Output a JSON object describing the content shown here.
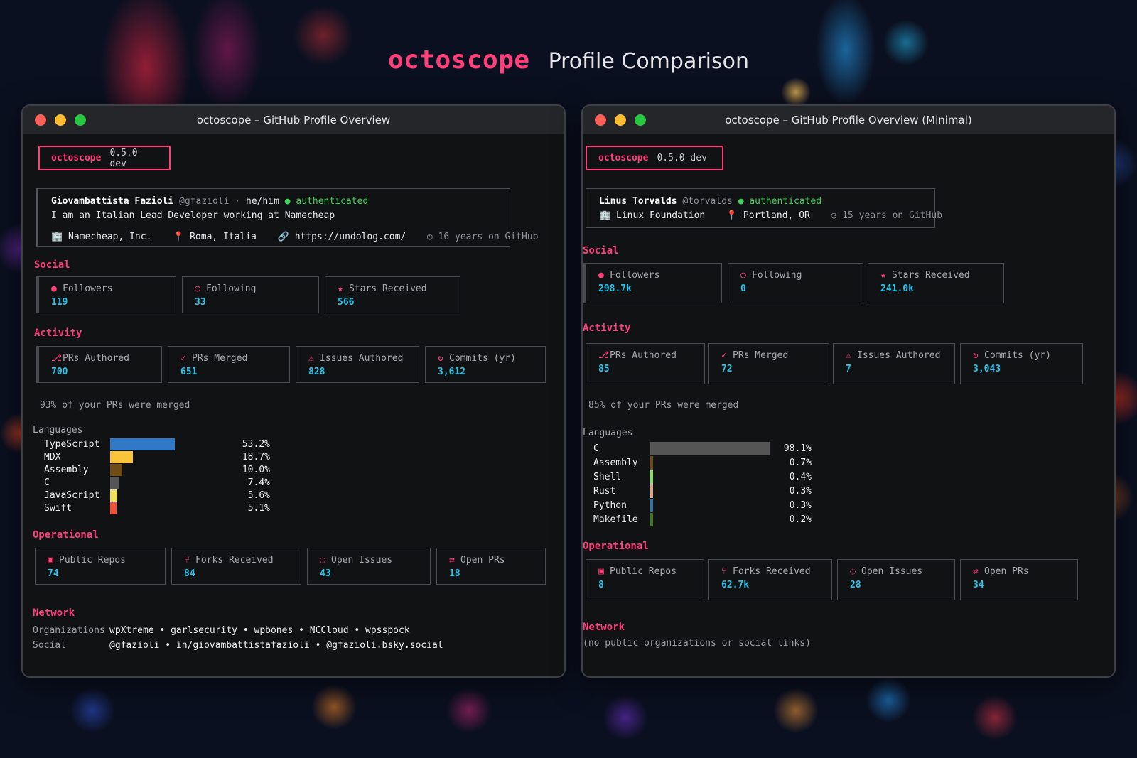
{
  "header": {
    "brand": "octoscope",
    "subtitle": "Profile Comparison"
  },
  "left": {
    "window_title": "octoscope – GitHub Profile Overview",
    "app_name": "octoscope",
    "app_version": "0.5.0-dev",
    "profile": {
      "name": "Giovambattista Fazioli",
      "handle": "@gfazioli",
      "separator": "·",
      "pronouns": "he/him",
      "auth_status": "● authenticated",
      "bio": "I am an Italian Lead Developer working at Namecheap",
      "company_icon": "🏢",
      "company": "Namecheap, Inc.",
      "location_icon": "📍",
      "location": "Roma, Italia",
      "link_icon": "🔗",
      "website": "https://undolog.com/",
      "clock_icon": "◷",
      "years": "16 years on GitHub"
    },
    "social_title": "Social",
    "social": [
      {
        "icon": "●",
        "label": "Followers",
        "value": "119"
      },
      {
        "icon": "○",
        "label": "Following",
        "value": "33"
      },
      {
        "icon": "★",
        "label": "Stars Received",
        "value": "566"
      }
    ],
    "activity_title": "Activity",
    "activity": [
      {
        "icon": "⎇",
        "label": "PRs Authored",
        "value": "700"
      },
      {
        "icon": "✓",
        "label": "PRs Merged",
        "value": "651"
      },
      {
        "icon": "⚠",
        "label": "Issues Authored",
        "value": "828"
      },
      {
        "icon": "↻",
        "label": "Commits (yr)",
        "value": "3,612"
      }
    ],
    "merge_note": "93% of your PRs were merged",
    "languages_title": "Languages",
    "languages": [
      {
        "name": "TypeScript",
        "percent": 53.2,
        "label": "53.2%",
        "color": "#3178c6"
      },
      {
        "name": "MDX",
        "percent": 18.7,
        "label": "18.7%",
        "color": "#f9c33a"
      },
      {
        "name": "Assembly",
        "percent": 10.0,
        "label": "10.0%",
        "color": "#6e4c13"
      },
      {
        "name": "C",
        "percent": 7.4,
        "label": "7.4%",
        "color": "#555555"
      },
      {
        "name": "JavaScript",
        "percent": 5.6,
        "label": "5.6%",
        "color": "#f1e05a"
      },
      {
        "name": "Swift",
        "percent": 5.1,
        "label": "5.1%",
        "color": "#f05138"
      }
    ],
    "operational_title": "Operational",
    "operational": [
      {
        "icon": "▣",
        "label": "Public Repos",
        "value": "74"
      },
      {
        "icon": "⑂",
        "label": "Forks Received",
        "value": "84"
      },
      {
        "icon": "◌",
        "label": "Open Issues",
        "value": "43"
      },
      {
        "icon": "⇄",
        "label": "Open PRs",
        "value": "18"
      }
    ],
    "network_title": "Network",
    "network": {
      "orgs_label": "Organizations",
      "orgs": "wpXtreme • garlsecurity • wpbones • NCCloud • wpsspock",
      "social_label": "Social",
      "social_links": "@gfazioli • in/giovambattistafazioli • @gfazioli.bsky.social"
    }
  },
  "right": {
    "window_title": "octoscope – GitHub Profile Overview (Minimal)",
    "app_name": "octoscope",
    "app_version": "0.5.0-dev",
    "profile": {
      "name": "Linus Torvalds",
      "handle": "@torvalds",
      "auth_status": "● authenticated",
      "company_icon": "🏢",
      "company": "Linux Foundation",
      "location_icon": "📍",
      "location": "Portland, OR",
      "clock_icon": "◷",
      "years": "15 years on GitHub"
    },
    "social_title": "Social",
    "social": [
      {
        "icon": "●",
        "label": "Followers",
        "value": "298.7k"
      },
      {
        "icon": "○",
        "label": "Following",
        "value": "0"
      },
      {
        "icon": "★",
        "label": "Stars Received",
        "value": "241.0k"
      }
    ],
    "activity_title": "Activity",
    "activity": [
      {
        "icon": "⎇",
        "label": "PRs Authored",
        "value": "85"
      },
      {
        "icon": "✓",
        "label": "PRs Merged",
        "value": "72"
      },
      {
        "icon": "⚠",
        "label": "Issues Authored",
        "value": "7"
      },
      {
        "icon": "↻",
        "label": "Commits (yr)",
        "value": "3,043"
      }
    ],
    "merge_note": "85% of your PRs were merged",
    "languages_title": "Languages",
    "languages": [
      {
        "name": "C",
        "percent": 98.1,
        "label": "98.1%",
        "color": "#555555"
      },
      {
        "name": "Assembly",
        "percent": 0.7,
        "label": "0.7%",
        "color": "#6e4c13"
      },
      {
        "name": "Shell",
        "percent": 0.4,
        "label": "0.4%",
        "color": "#89e051"
      },
      {
        "name": "Rust",
        "percent": 0.3,
        "label": "0.3%",
        "color": "#dea584"
      },
      {
        "name": "Python",
        "percent": 0.3,
        "label": "0.3%",
        "color": "#3572a5"
      },
      {
        "name": "Makefile",
        "percent": 0.2,
        "label": "0.2%",
        "color": "#427819"
      }
    ],
    "operational_title": "Operational",
    "operational": [
      {
        "icon": "▣",
        "label": "Public Repos",
        "value": "8"
      },
      {
        "icon": "⑂",
        "label": "Forks Received",
        "value": "62.7k"
      },
      {
        "icon": "◌",
        "label": "Open Issues",
        "value": "28"
      },
      {
        "icon": "⇄",
        "label": "Open PRs",
        "value": "34"
      }
    ],
    "network_title": "Network",
    "network": {
      "empty": "(no public organizations or social links)"
    }
  }
}
